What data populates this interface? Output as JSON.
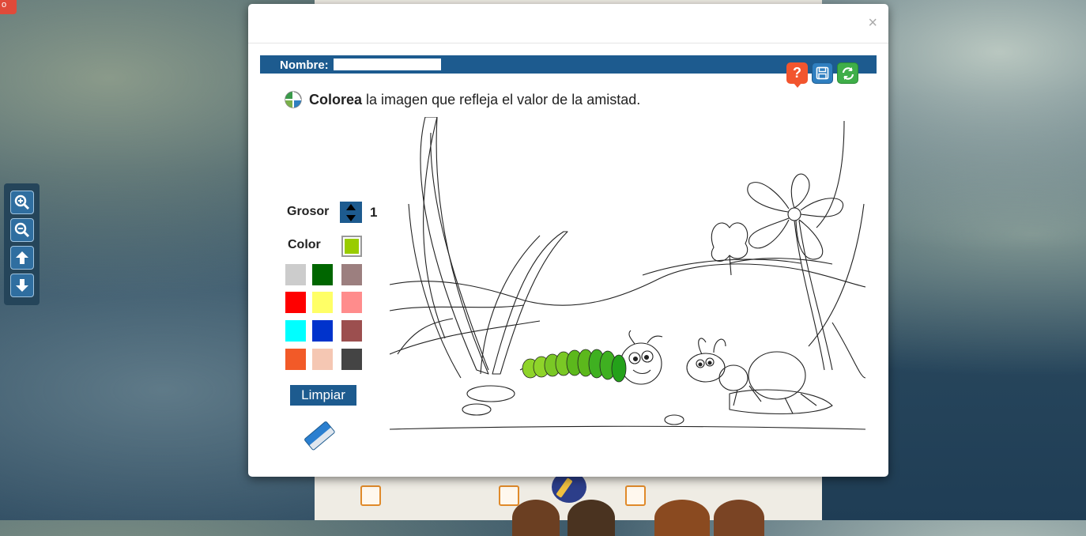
{
  "corner_badge": "o",
  "modal": {
    "close_symbol": "×",
    "name_label": "Nombre:",
    "name_value": "",
    "help_symbol": "?",
    "instruction_bold": "Colorea",
    "instruction_rest": "la imagen que refleja el valor de la amistad.",
    "grosor_label": "Grosor",
    "grosor_value": "1",
    "color_label": "Color",
    "current_color": "#99cc00",
    "clear_label": "Limpiar",
    "palette": [
      "#cccccc",
      "#006600",
      "#9c7f7f",
      "#ff0000",
      "#ffff66",
      "#ff8c8c",
      "#00ffff",
      "#0033cc",
      "#9c4f4f",
      "#f25a28",
      "#f5c7b3",
      "#444444"
    ]
  },
  "side_toolbar": {
    "buttons": [
      "zoom-in-icon",
      "zoom-out-icon",
      "arrow-up-icon",
      "arrow-down-icon"
    ]
  },
  "colors": {
    "header_blue": "#1d5b8f",
    "help_orange": "#f2552e",
    "reset_green": "#3fae49"
  }
}
